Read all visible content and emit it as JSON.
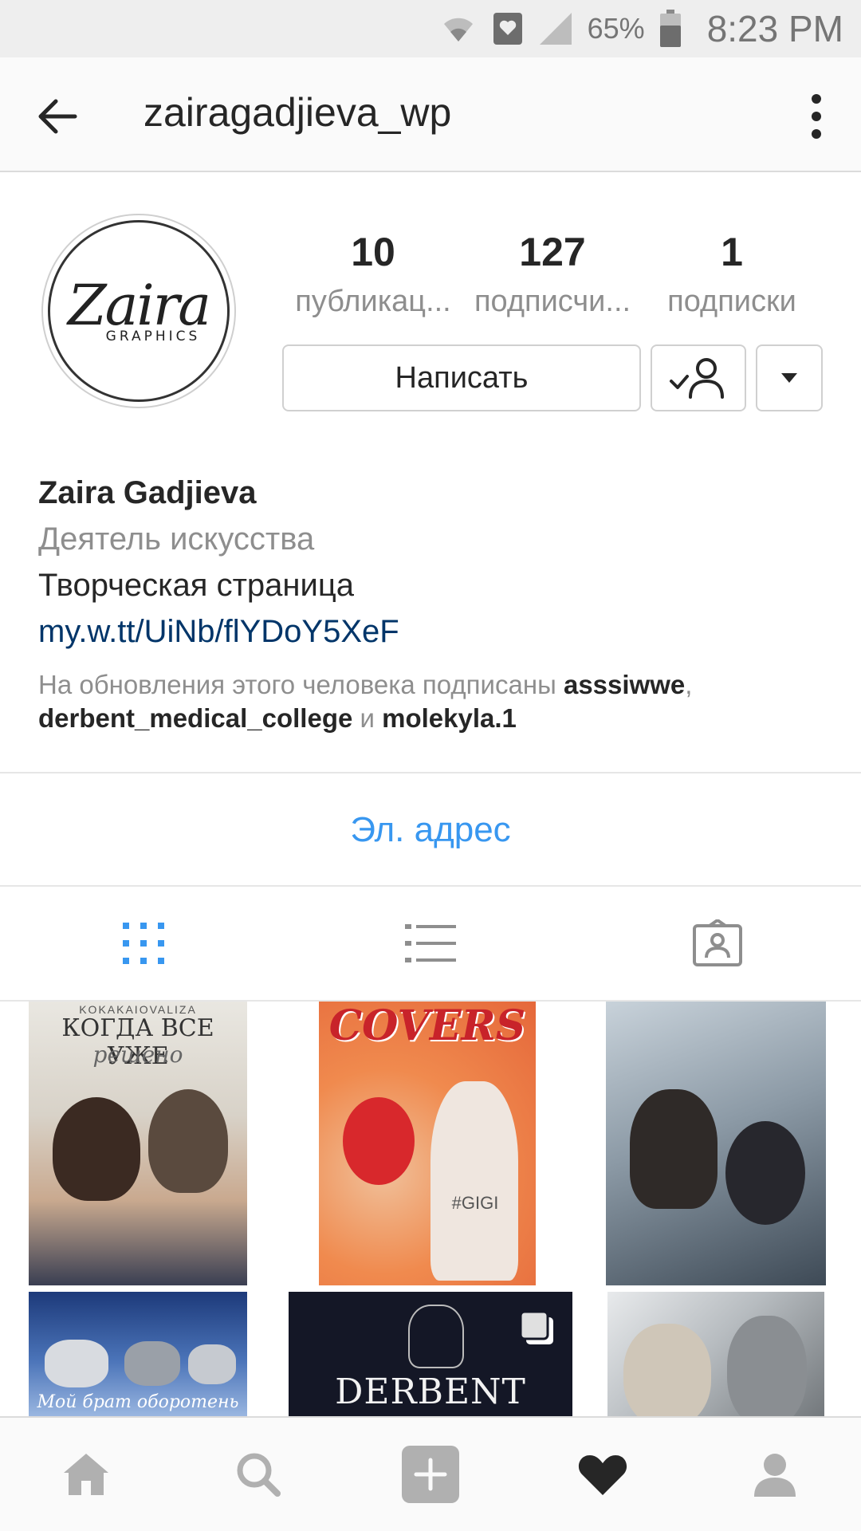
{
  "status_bar": {
    "battery": "65%",
    "time": "8:23 PM"
  },
  "app_bar": {
    "username": "zairagadjieva_wp"
  },
  "profile": {
    "avatar_logo_script": "Zaira",
    "avatar_logo_sub": "GRAPHICS",
    "stats": [
      {
        "value": "10",
        "label": "публикац..."
      },
      {
        "value": "127",
        "label": "подписчи..."
      },
      {
        "value": "1",
        "label": "подписки"
      }
    ],
    "message_button": "Написать",
    "name": "Zaira Gadjieva",
    "category": "Деятель искусства",
    "bio": "Творческая страница",
    "link": "my.w.tt/UiNb/flYDoY5XeF",
    "followed_by_prefix": "На обновления этого человека подписаны",
    "followed_by_user1": "asssiwwe",
    "followed_by_sep1": ",",
    "followed_by_user2": "derbent_medical_college",
    "followed_by_and": "и",
    "followed_by_user3": "molekyla.1"
  },
  "contact": {
    "email_label": "Эл. адрес"
  },
  "tabs": [
    {
      "name": "grid",
      "icon": "grid-icon",
      "active": true
    },
    {
      "name": "list",
      "icon": "list-icon",
      "active": false
    },
    {
      "name": "tagged",
      "icon": "tagged-icon",
      "active": false
    }
  ],
  "posts": [
    {
      "top_text": "KOKAKAIOVALIZA",
      "title": "КОГДА ВСЕ УЖЕ",
      "subtitle": "решено"
    },
    {
      "title": "COVERS",
      "badge": "#GIGI"
    },
    {
      "title": ""
    },
    {
      "caption": "Мой брат оборотень"
    },
    {
      "title": "DERBENT",
      "multi": true
    },
    {
      "title": ""
    }
  ],
  "colors": {
    "accent_blue": "#3897f0",
    "link_blue": "#003569",
    "muted": "#8e8e8e",
    "text": "#262626"
  }
}
